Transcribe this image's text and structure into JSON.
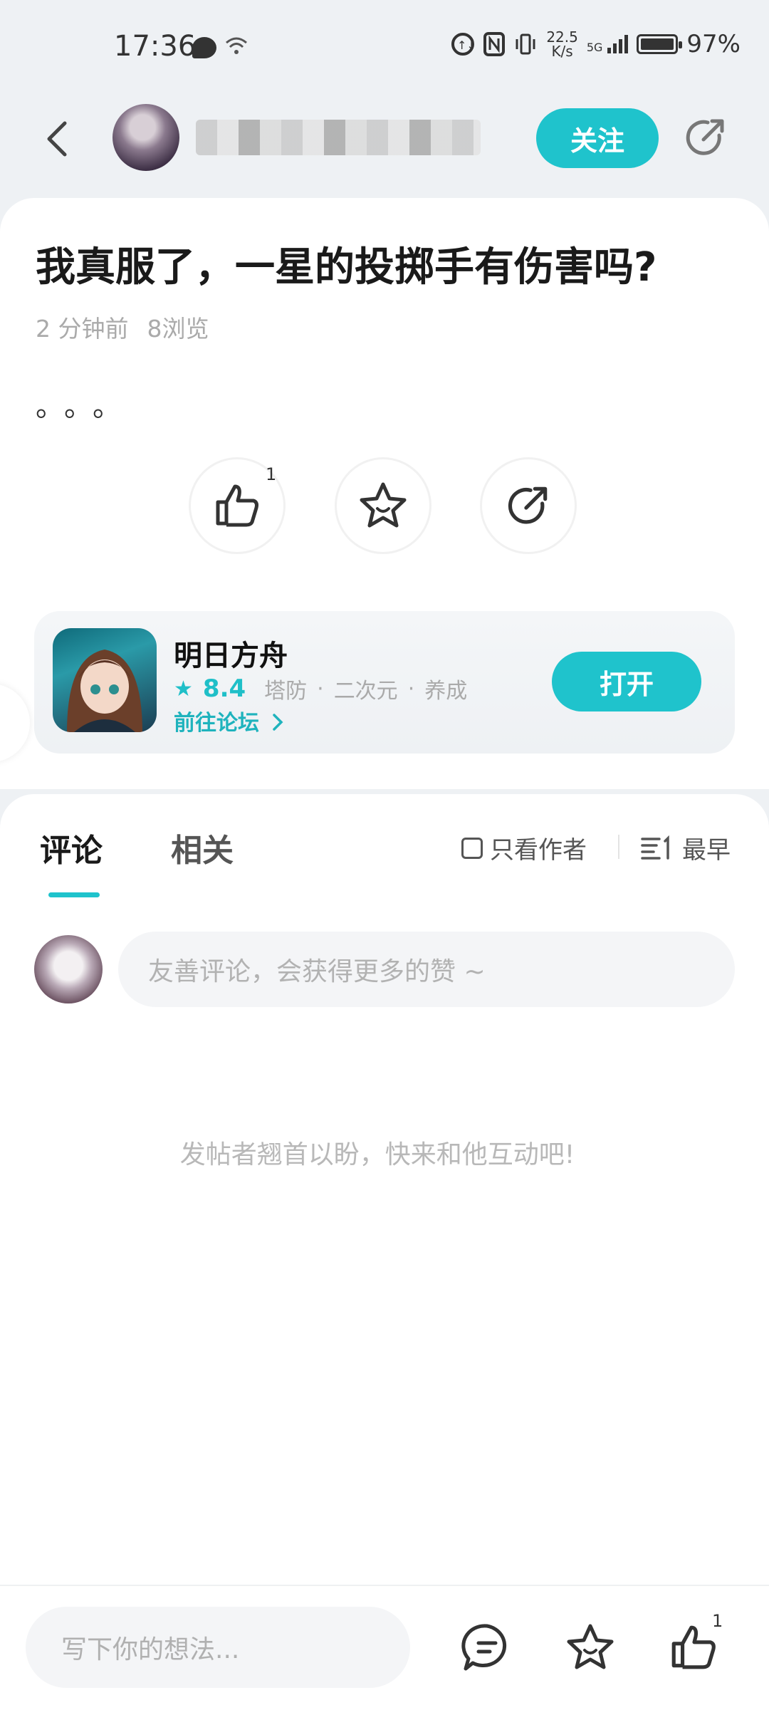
{
  "status_bar": {
    "time": "17:36",
    "net_speed_value": "22.5",
    "net_speed_unit": "K/s",
    "signal_label": "5G",
    "battery": "97%"
  },
  "header": {
    "follow_label": "关注"
  },
  "post": {
    "title": "我真服了，一星的投掷手有伤害吗?",
    "time_ago": "2 分钟前",
    "views": "8浏览",
    "body": "。。。",
    "like_count": "1"
  },
  "game": {
    "name": "明日方舟",
    "rating": "8.4",
    "tag1": "塔防",
    "tag2": "二次元",
    "tag3": "养成",
    "separator": "·",
    "forum_link": "前往论坛",
    "open_label": "打开"
  },
  "comments": {
    "tab_comments": "评论",
    "tab_related": "相关",
    "author_only": "只看作者",
    "sort_label": "最早",
    "input_placeholder": "友善评论，会获得更多的赞 ~",
    "empty_text": "发帖者翘首以盼，快来和他互动吧!"
  },
  "bottom_bar": {
    "input_placeholder": "写下你的想法...",
    "like_count": "1"
  },
  "colors": {
    "accent": "#1fc3cc",
    "background": "#eef1f4"
  }
}
